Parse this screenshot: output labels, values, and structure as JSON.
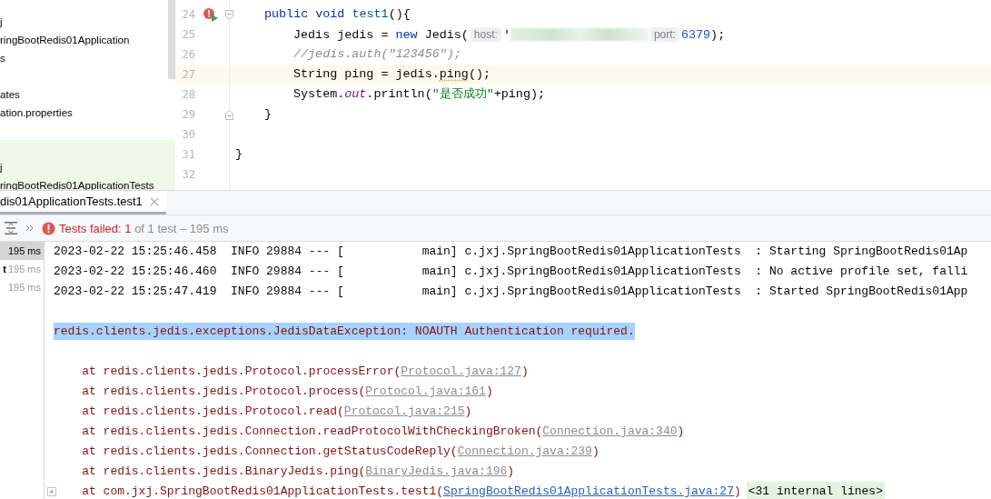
{
  "project_tree": {
    "items": [
      {
        "kind": "item",
        "label": "j",
        "highlighted": false
      },
      {
        "kind": "item",
        "label": "ringBootRedis01Application",
        "highlighted": false
      },
      {
        "kind": "item",
        "label": "s",
        "highlighted": false
      },
      {
        "kind": "blank",
        "highlighted": false
      },
      {
        "kind": "item",
        "label": "ates",
        "highlighted": false
      },
      {
        "kind": "item",
        "label": "ation.properties",
        "highlighted": false
      },
      {
        "kind": "blank",
        "highlighted": false
      },
      {
        "kind": "blank",
        "highlighted": true
      },
      {
        "kind": "item",
        "label": "j",
        "highlighted": true
      },
      {
        "kind": "item",
        "label": "ringBootRedis01ApplicationTests",
        "highlighted": true
      }
    ]
  },
  "editor": {
    "lines": [
      {
        "number": "24",
        "run_marker": true,
        "fold_start": true,
        "fold_end": false,
        "current": false,
        "kind": "member",
        "segments": [
          {
            "kind": "kw",
            "text": "public void "
          },
          {
            "kind": "decl",
            "text": "test1"
          },
          {
            "kind": "plain",
            "text": "(){"
          }
        ]
      },
      {
        "number": "25",
        "run_marker": false,
        "fold_start": false,
        "fold_end": false,
        "current": false,
        "kind": "statement",
        "segments": [
          {
            "kind": "plain",
            "text": "Jedis jedis = "
          },
          {
            "kind": "kw",
            "text": "new"
          },
          {
            "kind": "plain",
            "text": " Jedis("
          },
          {
            "kind": "hint",
            "text": "host:"
          },
          {
            "kind": "plain",
            "text": "'"
          },
          {
            "kind": "blur"
          },
          {
            "kind": "hint",
            "text": "port:"
          },
          {
            "kind": "num",
            "text": "6379"
          },
          {
            "kind": "plain",
            "text": ");"
          }
        ]
      },
      {
        "number": "26",
        "run_marker": false,
        "fold_start": false,
        "fold_end": false,
        "current": false,
        "kind": "statement",
        "segments": [
          {
            "kind": "comment",
            "text": "//jedis.auth(\"123456\");"
          }
        ]
      },
      {
        "number": "27",
        "run_marker": false,
        "fold_start": false,
        "fold_end": false,
        "current": true,
        "kind": "statement",
        "segments": [
          {
            "kind": "plain",
            "text": "String ping = jedis."
          },
          {
            "kind": "warn",
            "text": "ping"
          },
          {
            "kind": "plain",
            "text": "();"
          }
        ]
      },
      {
        "number": "28",
        "run_marker": false,
        "fold_start": false,
        "fold_end": false,
        "current": false,
        "kind": "statement",
        "segments": [
          {
            "kind": "plain",
            "text": "System."
          },
          {
            "kind": "field",
            "text": "out"
          },
          {
            "kind": "plain",
            "text": ".println("
          },
          {
            "kind": "string",
            "text": "\"是否成功\""
          },
          {
            "kind": "plain",
            "text": "+ping);"
          }
        ]
      },
      {
        "number": "29",
        "run_marker": false,
        "fold_start": false,
        "fold_end": true,
        "current": false,
        "kind": "member",
        "segments": [
          {
            "kind": "plain",
            "text": "}"
          }
        ]
      },
      {
        "number": "30",
        "run_marker": false,
        "fold_start": false,
        "fold_end": false,
        "current": false,
        "kind": "class"
      },
      {
        "number": "31",
        "run_marker": false,
        "fold_start": false,
        "fold_end": false,
        "current": false,
        "kind": "class",
        "segments": [
          {
            "kind": "plain",
            "text": "}"
          }
        ]
      },
      {
        "number": "32",
        "run_marker": false,
        "fold_start": false,
        "fold_end": false,
        "current": false,
        "kind": "class"
      }
    ]
  },
  "run_tab": {
    "label": "dis01ApplicationTests.test1",
    "selected": true
  },
  "toolbar": {
    "failed_label": "Tests failed:",
    "failed_count": "1",
    "summary": "of 1 test – 195 ms"
  },
  "test_tree": [
    {
      "time": "195 ms",
      "selected": true
    },
    {
      "name": "t",
      "time": "195 ms",
      "selected": false
    },
    {
      "time": "195 ms",
      "selected": false
    }
  ],
  "console": {
    "lines": [
      {
        "kind": "log",
        "selected": false,
        "fold_icon": false,
        "segments": [
          {
            "kind": "text",
            "text": "2023-02-22 15:25:46.458  INFO 29884 --- [           main] c.jxj.SpringBootRedis01ApplicationTests  : Starting SpringBootRedis01Ap"
          }
        ]
      },
      {
        "kind": "log",
        "selected": false,
        "fold_icon": false,
        "segments": [
          {
            "kind": "text",
            "text": "2023-02-22 15:25:46.460  INFO 29884 --- [           main] c.jxj.SpringBootRedis01ApplicationTests  : No active profile set, falli"
          }
        ]
      },
      {
        "kind": "log",
        "selected": false,
        "fold_icon": false,
        "segments": [
          {
            "kind": "text",
            "text": "2023-02-22 15:25:47.419  INFO 29884 --- [           main] c.jxj.SpringBootRedis01ApplicationTests  : Started SpringBootRedis01App"
          }
        ]
      },
      {
        "kind": "blank"
      },
      {
        "kind": "error",
        "selected": true,
        "fold_icon": false,
        "segments": [
          {
            "kind": "text",
            "text": "redis.clients.jedis.exceptions.JedisDataException: NOAUTH Authentication required."
          }
        ]
      },
      {
        "kind": "blank"
      },
      {
        "kind": "error",
        "selected": false,
        "fold_icon": false,
        "segments": [
          {
            "kind": "text",
            "text": "    at redis.clients.jedis.Protocol.processError("
          },
          {
            "kind": "link",
            "text": "Protocol.java:127"
          },
          {
            "kind": "text",
            "text": ")"
          }
        ]
      },
      {
        "kind": "error",
        "selected": false,
        "fold_icon": false,
        "segments": [
          {
            "kind": "text",
            "text": "    at redis.clients.jedis.Protocol.process("
          },
          {
            "kind": "link",
            "text": "Protocol.java:161"
          },
          {
            "kind": "text",
            "text": ")"
          }
        ]
      },
      {
        "kind": "error",
        "selected": false,
        "fold_icon": false,
        "segments": [
          {
            "kind": "text",
            "text": "    at redis.clients.jedis.Protocol.read("
          },
          {
            "kind": "link",
            "text": "Protocol.java:215"
          },
          {
            "kind": "text",
            "text": ")"
          }
        ]
      },
      {
        "kind": "error",
        "selected": false,
        "fold_icon": false,
        "segments": [
          {
            "kind": "text",
            "text": "    at redis.clients.jedis.Connection.readProtocolWithCheckingBroken("
          },
          {
            "kind": "link",
            "text": "Connection.java:340"
          },
          {
            "kind": "text",
            "text": ")"
          }
        ]
      },
      {
        "kind": "error",
        "selected": false,
        "fold_icon": false,
        "segments": [
          {
            "kind": "text",
            "text": "    at redis.clients.jedis.Connection.getStatusCodeReply("
          },
          {
            "kind": "link",
            "text": "Connection.java:239"
          },
          {
            "kind": "text",
            "text": ")"
          }
        ]
      },
      {
        "kind": "error",
        "selected": false,
        "fold_icon": false,
        "segments": [
          {
            "kind": "text",
            "text": "    at redis.clients.jedis.BinaryJedis.ping("
          },
          {
            "kind": "link",
            "text": "BinaryJedis.java:196"
          },
          {
            "kind": "text",
            "text": ")"
          }
        ]
      },
      {
        "kind": "error",
        "selected": false,
        "fold_icon": true,
        "segments": [
          {
            "kind": "text",
            "text": "    at com.jxj.SpringBootRedis01ApplicationTests.test1("
          },
          {
            "kind": "link-own",
            "text": "SpringBootRedis01ApplicationTests.java:27"
          },
          {
            "kind": "text",
            "text": ")"
          },
          {
            "kind": "folded",
            "text": "<31 internal lines>"
          }
        ]
      }
    ]
  }
}
